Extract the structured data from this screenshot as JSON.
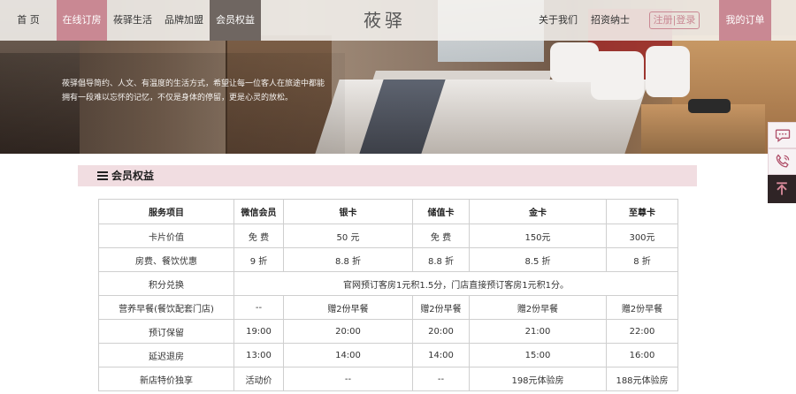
{
  "nav": {
    "home": "首 页",
    "online_booking": "在线订房",
    "living": "莜驿生活",
    "franchise": "品牌加盟",
    "member_benefits": "会员权益",
    "logo_text": "莜驿",
    "about": "关于我们",
    "investment": "招资纳士",
    "register": "注册|登录",
    "my_orders": "我的订单"
  },
  "hero": {
    "tagline_line1": "莜驿倡导简约、人文、有温度的生活方式，希望让每一位客人在旅途中都能",
    "tagline_line2": "拥有一段难以忘怀的记忆，不仅是身体的停留，更是心灵的放松。"
  },
  "section": {
    "title": "会员权益"
  },
  "table": {
    "headers": [
      "服务项目",
      "微信会员",
      "银卡",
      "储值卡",
      "金卡",
      "至尊卡"
    ],
    "rows": [
      [
        "卡片价值",
        "免 费",
        "50 元",
        "免 费",
        "150元",
        "300元"
      ],
      [
        "房费、餐饮优惠",
        "9 折",
        "8.8 折",
        "8.8 折",
        "8.5 折",
        "8 折"
      ]
    ],
    "points_row": {
      "label": "积分兑换",
      "value": "官网预订客房1元积1.5分，门店直接预订客房1元积1分。"
    },
    "rows_after": [
      [
        "营养早餐(餐饮配套门店)",
        "--",
        "赠2份早餐",
        "赠2份早餐",
        "赠2份早餐",
        "赠2份早餐"
      ],
      [
        "预订保留",
        "19:00",
        "20:00",
        "20:00",
        "21:00",
        "22:00"
      ],
      [
        "延迟退房",
        "13:00",
        "14:00",
        "14:00",
        "15:00",
        "16:00"
      ],
      [
        "新店特价独享",
        "活动价",
        "--",
        "--",
        "198元体验房",
        "188元体验房"
      ]
    ]
  },
  "side_float": {
    "icons": [
      "chat-icon",
      "phone-icon",
      "back-to-top-icon"
    ]
  },
  "colors": {
    "accent": "#c98893",
    "section_bg": "#f1dde1",
    "nav_dark": "#6f6661"
  }
}
